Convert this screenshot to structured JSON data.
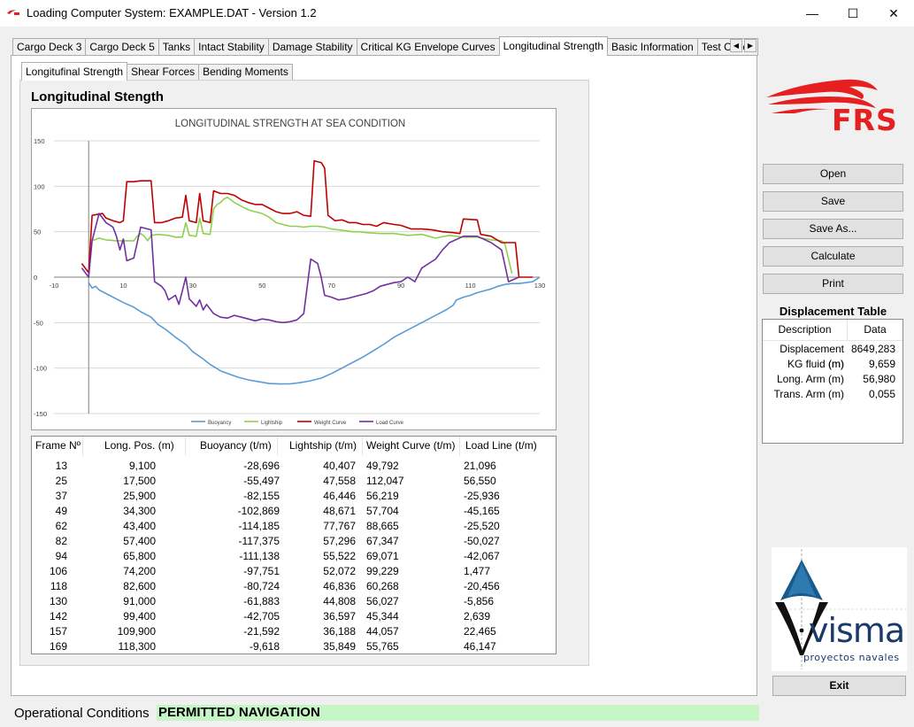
{
  "window": {
    "title": "Loading Computer System: EXAMPLE.DAT - Version 1.2",
    "minimize_glyph": "—",
    "maximize_glyph": "☐",
    "close_glyph": "✕"
  },
  "main_tabs": [
    {
      "label": "Cargo Deck 3"
    },
    {
      "label": "Cargo Deck 5"
    },
    {
      "label": "Tanks"
    },
    {
      "label": "Intact Stability"
    },
    {
      "label": "Damage Stability"
    },
    {
      "label": "Critical KG Envelope Curves"
    },
    {
      "label": "Longitudinal Strength"
    },
    {
      "label": "Basic Information"
    },
    {
      "label": "Test Cases"
    }
  ],
  "sub_tabs": [
    {
      "label": "Longitufinal Strength"
    },
    {
      "label": "Shear Forces"
    },
    {
      "label": "Bending Moments"
    }
  ],
  "section_title": "Longitudinal Stength",
  "chart_data": {
    "type": "line",
    "title": "LONGITUDINAL STRENGTH AT SEA CONDITION",
    "xlabel": "",
    "ylabel": "",
    "xlim": [
      -10,
      130
    ],
    "ylim": [
      -150,
      150
    ],
    "x_ticks": [
      -10,
      10,
      30,
      50,
      70,
      90,
      110,
      130
    ],
    "y_ticks": [
      150,
      100,
      50,
      0,
      -50,
      -100,
      -150
    ],
    "grid": true,
    "legend_position": "bottom",
    "series": [
      {
        "name": "Buoyancy",
        "color": "#5b9bd5",
        "points": [
          [
            0,
            -6
          ],
          [
            1,
            -12
          ],
          [
            2,
            -10
          ],
          [
            3,
            -14
          ],
          [
            5,
            -18
          ],
          [
            8,
            -24
          ],
          [
            10,
            -28
          ],
          [
            13,
            -33
          ],
          [
            15,
            -38
          ],
          [
            18,
            -44
          ],
          [
            20,
            -52
          ],
          [
            22,
            -57
          ],
          [
            25,
            -66
          ],
          [
            28,
            -74
          ],
          [
            30,
            -82
          ],
          [
            33,
            -90
          ],
          [
            35,
            -96
          ],
          [
            38,
            -103
          ],
          [
            40,
            -106
          ],
          [
            43,
            -110
          ],
          [
            46,
            -113
          ],
          [
            49,
            -115
          ],
          [
            52,
            -117
          ],
          [
            55,
            -117.5
          ],
          [
            58,
            -117.4
          ],
          [
            61,
            -116
          ],
          [
            64,
            -114
          ],
          [
            67,
            -111
          ],
          [
            70,
            -106
          ],
          [
            73,
            -100
          ],
          [
            76,
            -94
          ],
          [
            79,
            -88
          ],
          [
            82,
            -81
          ],
          [
            85,
            -74
          ],
          [
            88,
            -66
          ],
          [
            91,
            -60
          ],
          [
            94,
            -54
          ],
          [
            97,
            -48
          ],
          [
            100,
            -42
          ],
          [
            103,
            -36
          ],
          [
            105,
            -31
          ],
          [
            106,
            -25
          ],
          [
            108,
            -22
          ],
          [
            110,
            -20
          ],
          [
            112,
            -17
          ],
          [
            114,
            -15
          ],
          [
            116,
            -13
          ],
          [
            118,
            -10
          ],
          [
            120,
            -8
          ],
          [
            122,
            -7
          ],
          [
            124,
            -7
          ],
          [
            126,
            -6
          ],
          [
            128,
            -5
          ],
          [
            130,
            0
          ]
        ]
      },
      {
        "name": "Lightship",
        "color": "#8fd14f",
        "points": [
          [
            1,
            40
          ],
          [
            3,
            43
          ],
          [
            5,
            41
          ],
          [
            8,
            40
          ],
          [
            12,
            40
          ],
          [
            13,
            40
          ],
          [
            14,
            45
          ],
          [
            15,
            48
          ],
          [
            16,
            45
          ],
          [
            17,
            40
          ],
          [
            18,
            46
          ],
          [
            20,
            47
          ],
          [
            23,
            46
          ],
          [
            25,
            44
          ],
          [
            27,
            44
          ],
          [
            28,
            60
          ],
          [
            29,
            46
          ],
          [
            31,
            45
          ],
          [
            32,
            65
          ],
          [
            33,
            48
          ],
          [
            35,
            47
          ],
          [
            36,
            75
          ],
          [
            37,
            80
          ],
          [
            38,
            82
          ],
          [
            39,
            86
          ],
          [
            40,
            88
          ],
          [
            42,
            82
          ],
          [
            44,
            78
          ],
          [
            46,
            74
          ],
          [
            48,
            72
          ],
          [
            50,
            70
          ],
          [
            52,
            66
          ],
          [
            54,
            60
          ],
          [
            56,
            58
          ],
          [
            58,
            56
          ],
          [
            60,
            56
          ],
          [
            62,
            55
          ],
          [
            64,
            56
          ],
          [
            66,
            56
          ],
          [
            68,
            55
          ],
          [
            70,
            53
          ],
          [
            72,
            52
          ],
          [
            74,
            51
          ],
          [
            76,
            50
          ],
          [
            78,
            50
          ],
          [
            80,
            49
          ],
          [
            84,
            48
          ],
          [
            88,
            48
          ],
          [
            92,
            46
          ],
          [
            96,
            47
          ],
          [
            100,
            43
          ],
          [
            104,
            46
          ],
          [
            108,
            44
          ],
          [
            112,
            44
          ],
          [
            116,
            41
          ],
          [
            119,
            40
          ],
          [
            120,
            36
          ],
          [
            122,
            4
          ]
        ]
      },
      {
        "name": "Weight Curve",
        "color": "#c00000",
        "points": [
          [
            -2,
            15
          ],
          [
            0,
            5
          ],
          [
            1,
            68
          ],
          [
            4,
            70
          ],
          [
            5,
            65
          ],
          [
            7,
            62
          ],
          [
            9,
            60
          ],
          [
            10,
            62
          ],
          [
            11,
            105
          ],
          [
            13,
            105
          ],
          [
            15,
            106
          ],
          [
            18,
            106
          ],
          [
            19,
            60
          ],
          [
            21,
            60
          ],
          [
            23,
            62
          ],
          [
            25,
            65
          ],
          [
            27,
            66
          ],
          [
            28,
            90
          ],
          [
            29,
            62
          ],
          [
            31,
            60
          ],
          [
            32,
            92
          ],
          [
            33,
            62
          ],
          [
            35,
            60
          ],
          [
            36,
            95
          ],
          [
            38,
            92
          ],
          [
            40,
            92
          ],
          [
            42,
            90
          ],
          [
            44,
            85
          ],
          [
            46,
            82
          ],
          [
            48,
            80
          ],
          [
            50,
            80
          ],
          [
            52,
            76
          ],
          [
            54,
            72
          ],
          [
            56,
            70
          ],
          [
            58,
            70
          ],
          [
            60,
            72
          ],
          [
            62,
            68
          ],
          [
            64,
            67
          ],
          [
            65,
            128
          ],
          [
            67,
            126
          ],
          [
            68,
            120
          ],
          [
            69,
            68
          ],
          [
            71,
            62
          ],
          [
            73,
            63
          ],
          [
            75,
            60
          ],
          [
            77,
            60
          ],
          [
            79,
            58
          ],
          [
            81,
            58
          ],
          [
            83,
            56
          ],
          [
            85,
            60
          ],
          [
            88,
            58
          ],
          [
            90,
            57
          ],
          [
            93,
            53
          ],
          [
            96,
            53
          ],
          [
            99,
            52
          ],
          [
            102,
            50
          ],
          [
            105,
            49
          ],
          [
            107,
            48
          ],
          [
            108,
            64
          ],
          [
            112,
            63
          ],
          [
            113,
            47
          ],
          [
            116,
            45
          ],
          [
            119,
            38
          ],
          [
            123,
            38
          ],
          [
            124,
            0
          ],
          [
            128,
            0
          ]
        ]
      },
      {
        "name": "Load Curve",
        "color": "#7030a0",
        "points": [
          [
            -2,
            10
          ],
          [
            0,
            0
          ],
          [
            1,
            40
          ],
          [
            3,
            70
          ],
          [
            5,
            60
          ],
          [
            7,
            55
          ],
          [
            8,
            45
          ],
          [
            9,
            30
          ],
          [
            10,
            42
          ],
          [
            11,
            18
          ],
          [
            13,
            21
          ],
          [
            15,
            55
          ],
          [
            18,
            52
          ],
          [
            19,
            -5
          ],
          [
            21,
            -10
          ],
          [
            22,
            -15
          ],
          [
            23,
            -25
          ],
          [
            25,
            -20
          ],
          [
            26,
            -30
          ],
          [
            27,
            -15
          ],
          [
            28,
            0
          ],
          [
            29,
            -24
          ],
          [
            30,
            -28
          ],
          [
            31,
            -32
          ],
          [
            32,
            -25
          ],
          [
            33,
            -36
          ],
          [
            34,
            -30
          ],
          [
            36,
            -40
          ],
          [
            38,
            -44
          ],
          [
            40,
            -45
          ],
          [
            42,
            -42
          ],
          [
            44,
            -44
          ],
          [
            46,
            -46
          ],
          [
            48,
            -48
          ],
          [
            50,
            -46
          ],
          [
            52,
            -47
          ],
          [
            54,
            -49
          ],
          [
            56,
            -50
          ],
          [
            58,
            -49
          ],
          [
            60,
            -47
          ],
          [
            62,
            -40
          ],
          [
            64,
            20
          ],
          [
            66,
            15
          ],
          [
            67,
            0
          ],
          [
            68,
            -20
          ],
          [
            70,
            -22
          ],
          [
            72,
            -25
          ],
          [
            74,
            -24
          ],
          [
            76,
            -22
          ],
          [
            78,
            -20
          ],
          [
            80,
            -18
          ],
          [
            82,
            -15
          ],
          [
            84,
            -10
          ],
          [
            86,
            -8
          ],
          [
            88,
            -6
          ],
          [
            90,
            -5
          ],
          [
            92,
            0
          ],
          [
            94,
            -5
          ],
          [
            96,
            10
          ],
          [
            100,
            20
          ],
          [
            102,
            30
          ],
          [
            104,
            38
          ],
          [
            108,
            45
          ],
          [
            112,
            45
          ],
          [
            116,
            38
          ],
          [
            119,
            30
          ],
          [
            121,
            -5
          ],
          [
            124,
            0
          ]
        ]
      }
    ]
  },
  "table": {
    "columns": [
      "Frame Nº",
      "Long. Pos. (m)",
      "Buoyancy (t/m)",
      "Lightship (t/m)",
      "Weight Curve (t/m)",
      "Load Line (t/m)"
    ],
    "rows": [
      [
        "13",
        "9,100",
        "-28,696",
        "40,407",
        "49,792",
        "21,096"
      ],
      [
        "25",
        "17,500",
        "-55,497",
        "47,558",
        "112,047",
        "56,550"
      ],
      [
        "37",
        "25,900",
        "-82,155",
        "46,446",
        "56,219",
        "-25,936"
      ],
      [
        "49",
        "34,300",
        "-102,869",
        "48,671",
        "57,704",
        "-45,165"
      ],
      [
        "62",
        "43,400",
        "-114,185",
        "77,767",
        "88,665",
        "-25,520"
      ],
      [
        "82",
        "57,400",
        "-117,375",
        "57,296",
        "67,347",
        "-50,027"
      ],
      [
        "94",
        "65,800",
        "-111,138",
        "55,522",
        "69,071",
        "-42,067"
      ],
      [
        "106",
        "74,200",
        "-97,751",
        "52,072",
        "99,229",
        "1,477"
      ],
      [
        "118",
        "82,600",
        "-80,724",
        "46,836",
        "60,268",
        "-20,456"
      ],
      [
        "130",
        "91,000",
        "-61,883",
        "44,808",
        "56,027",
        "-5,856"
      ],
      [
        "142",
        "99,400",
        "-42,705",
        "36,597",
        "45,344",
        "2,639"
      ],
      [
        "157",
        "109,900",
        "-21,592",
        "36,188",
        "44,057",
        "22,465"
      ],
      [
        "169",
        "118,300",
        "-9,618",
        "35,849",
        "55,765",
        "46,147"
      ]
    ]
  },
  "logo_frs": {
    "text": "FRS",
    "color": "#e62020"
  },
  "buttons": {
    "open": "Open",
    "save": "Save",
    "save_as": "Save As...",
    "calculate": "Calculate",
    "print": "Print",
    "exit": "Exit"
  },
  "displacement": {
    "title": "Displacement Table",
    "col_description": "Description",
    "col_data": "Data",
    "rows": [
      [
        "Displacement (m)",
        "8649,283"
      ],
      [
        "KG fluid (m)",
        "9,659"
      ],
      [
        "Long. Arm (m)",
        "56,980"
      ],
      [
        "Trans. Arm (m)",
        "0,055"
      ]
    ]
  },
  "logo_visma": {
    "name": "visma",
    "tagline": "proyectos navales",
    "color": "#1a3a6b"
  },
  "status": {
    "label": "Operational Conditions",
    "value": "PERMITTED NAVIGATION",
    "value_bg": "#c6f5c6"
  }
}
